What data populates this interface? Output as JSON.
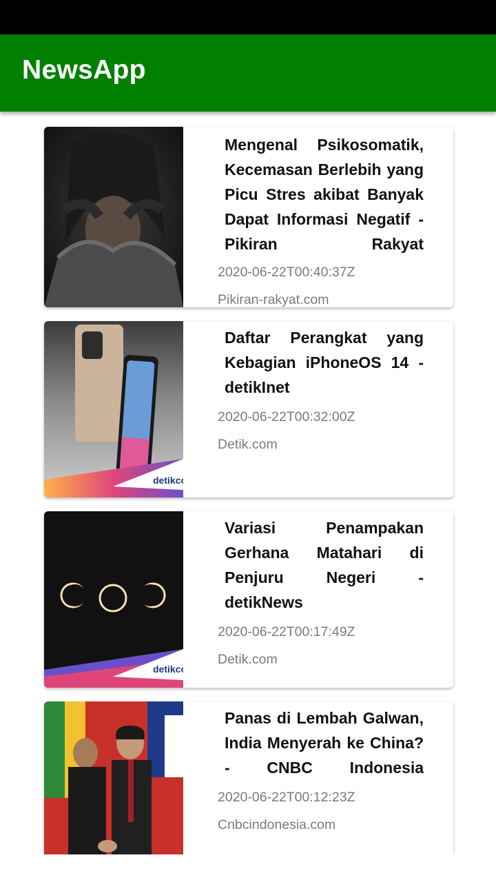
{
  "app": {
    "title": "NewsApp"
  },
  "colors": {
    "app_bar": "#007F00",
    "status_bar": "#000000"
  },
  "articles": [
    {
      "title": "Mengenal Psikosomatik, Kecemasan Berlebih yang Picu Stres akibat Banyak Dapat Informasi Negatif - Pikiran Rakyat",
      "published_at": "2020-06-22T00:40:37Z",
      "source": "Pikiran-rakyat.com",
      "image": "stressed-woman-image"
    },
    {
      "title": "Daftar Perangkat yang Kebagian iPhoneOS 14 - detikInet",
      "published_at": "2020-06-22T00:32:00Z",
      "source": "Detik.com",
      "image": "iphones-image"
    },
    {
      "title": "Variasi Penampakan Gerhana Matahari di Penjuru Negeri - detikNews",
      "published_at": "2020-06-22T00:17:49Z",
      "source": "Detik.com",
      "image": "solar-eclipse-image"
    },
    {
      "title": "Panas di Lembah Galwan, India Menyerah ke China? - CNBC Indonesia",
      "published_at": "2020-06-22T00:12:23Z",
      "source": "Cnbcindonesia.com",
      "image": "leaders-handshake-image"
    }
  ]
}
